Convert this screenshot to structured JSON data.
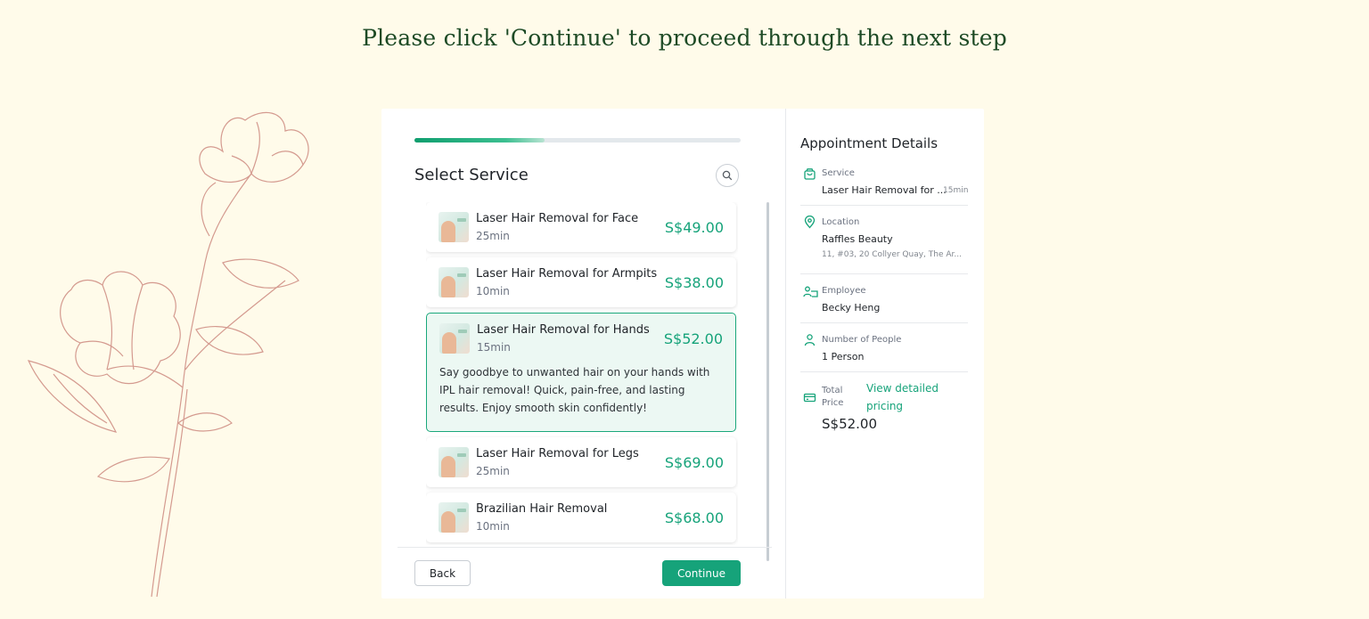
{
  "headline": "Please click 'Continue' to proceed through the next step",
  "progress_fraction": 0.4,
  "section_title": "Select Service",
  "colors": {
    "accent": "#16a37a",
    "background": "#fffbea",
    "headline": "#1d4a25"
  },
  "services": [
    {
      "name": "Laser Hair Removal for Face",
      "duration": "25min",
      "price": "S$49.00",
      "selected": false
    },
    {
      "name": "Laser Hair Removal for Armpits",
      "duration": "10min",
      "price": "S$38.00",
      "selected": false
    },
    {
      "name": "Laser Hair Removal for Hands",
      "duration": "15min",
      "price": "S$52.00",
      "selected": true,
      "description": "Say goodbye to unwanted hair on your hands with IPL hair removal! Quick, pain-free, and lasting results. Enjoy smooth skin confidently!"
    },
    {
      "name": "Laser Hair Removal for Legs",
      "duration": "25min",
      "price": "S$69.00",
      "selected": false
    },
    {
      "name": "Brazilian Hair Removal",
      "duration": "10min",
      "price": "S$68.00",
      "selected": false
    }
  ],
  "buttons": {
    "back": "Back",
    "continue": "Continue"
  },
  "details": {
    "title": "Appointment Details",
    "service_label": "Service",
    "service_value": "Laser Hair Removal for ...",
    "service_duration": "15min",
    "location_label": "Location",
    "location_value": "Raffles Beauty",
    "location_address": "11, #03, 20 Collyer Quay, The Ar...",
    "employee_label": "Employee",
    "employee_value": "Becky Heng",
    "people_label": "Number of People",
    "people_value": "1 Person",
    "total_label_1": "Total",
    "total_label_2": "Price",
    "pricing_link_1": "View detailed",
    "pricing_link_2": "pricing",
    "total_value": "S$52.00"
  },
  "icons": [
    "flower-illustration",
    "search-icon",
    "bag-icon",
    "location-pin-icon",
    "employee-icon",
    "person-icon",
    "card-icon"
  ]
}
